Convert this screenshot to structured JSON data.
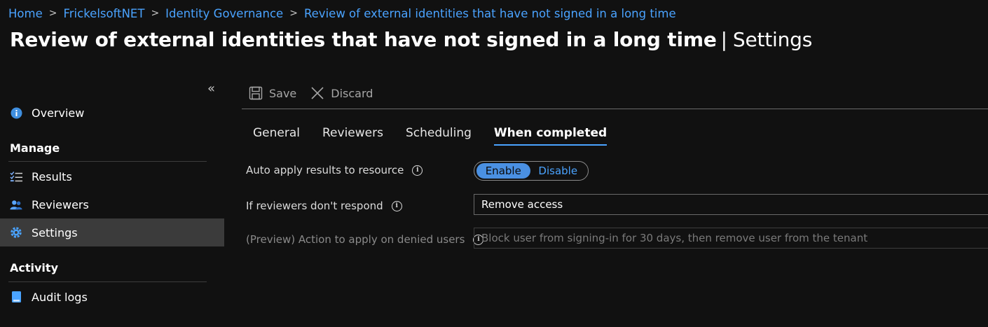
{
  "breadcrumb": {
    "items": [
      "Home",
      "FrickelsoftNET",
      "Identity Governance",
      "Review of external identities that have not signed in a long time"
    ],
    "separator": ">"
  },
  "page": {
    "title": "Review of external identities that have not signed in a long time",
    "title_separator": "|",
    "section": "Settings"
  },
  "sidebar": {
    "collapse_glyph": "«",
    "overview": {
      "label": "Overview",
      "icon": "info-icon"
    },
    "groups": [
      {
        "header": "Manage",
        "items": [
          {
            "label": "Results",
            "icon": "checklist-icon"
          },
          {
            "label": "Reviewers",
            "icon": "users-icon"
          },
          {
            "label": "Settings",
            "icon": "gear-icon",
            "active": true
          }
        ]
      },
      {
        "header": "Activity",
        "items": [
          {
            "label": "Audit logs",
            "icon": "book-icon"
          }
        ]
      }
    ]
  },
  "toolbar": {
    "save_label": "Save",
    "discard_label": "Discard"
  },
  "tabs": [
    "General",
    "Reviewers",
    "Scheduling",
    "When completed"
  ],
  "active_tab": "When completed",
  "form": {
    "auto_apply": {
      "label": "Auto apply results to resource",
      "options": [
        "Enable",
        "Disable"
      ],
      "selected": "Enable"
    },
    "no_response": {
      "label": "If reviewers don't respond",
      "value": "Remove access"
    },
    "denied_action": {
      "label": "(Preview) Action to apply on denied users",
      "value": "Block user from signing-in for 30 days, then remove user from the tenant",
      "disabled": true
    }
  },
  "colors": {
    "accent": "#4aa3ff",
    "toggle_on": "#4a90e2",
    "background": "#111111",
    "active_nav": "#3b3b3b"
  }
}
